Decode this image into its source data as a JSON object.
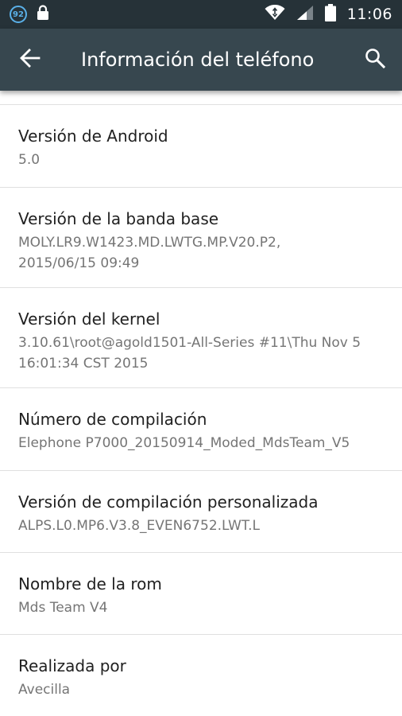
{
  "status_bar": {
    "notification_badge": "92",
    "time": "11:06"
  },
  "app_bar": {
    "title": "Información del teléfono"
  },
  "items": [
    {
      "title": "Versión de Android",
      "summary": "5.0"
    },
    {
      "title": "Versión de la banda base",
      "summary": "MOLY.LR9.W1423.MD.LWTG.MP.V20.P2,\n2015/06/15 09:49"
    },
    {
      "title": "Versión del kernel",
      "summary": "3.10.61\\root@agold1501-All-Series #11\\Thu Nov 5\n16:01:34 CST 2015"
    },
    {
      "title": "Número de compilación",
      "summary": "Elephone P7000_20150914_Moded_MdsTeam_V5"
    },
    {
      "title": "Versión de compilación personalizada",
      "summary": "ALPS.L0.MP6.V3.8_EVEN6752.LWT.L"
    },
    {
      "title": "Nombre de la rom",
      "summary": "Mds Team V4"
    },
    {
      "title": "Realizada por",
      "summary": "Avecilla"
    }
  ],
  "icons": {
    "back": "arrow-back-icon",
    "search": "search-icon",
    "wifi": "wifi-icon",
    "signal": "signal-icon",
    "battery": "battery-icon",
    "lock": "lock-icon"
  },
  "colors": {
    "status_bar": "#263238",
    "app_bar": "#37474f",
    "badge": "#5ab0e8",
    "title_text": "#212121",
    "summary_text": "#757575",
    "divider": "#e0e0e0"
  }
}
